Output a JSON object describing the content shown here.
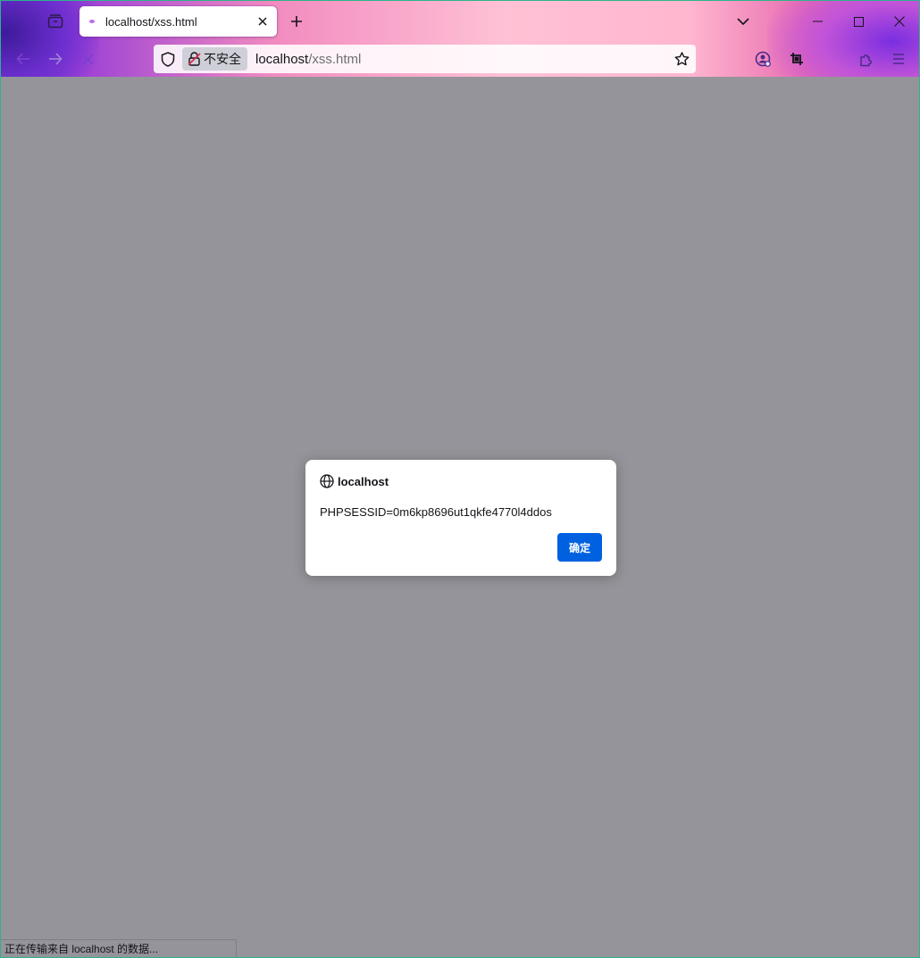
{
  "tab": {
    "title": "localhost/xss.html"
  },
  "urlbar": {
    "security_label": "不安全",
    "host": "localhost",
    "path": "/xss.html"
  },
  "icons": {
    "tab_tray": "firefox-view-icon",
    "close_tab": "close-icon",
    "new_tab": "plus-icon",
    "list_all_tabs": "chevron-down-icon",
    "back": "arrow-left-icon",
    "forward": "arrow-right-icon",
    "stop": "stop-icon",
    "tracking_protection": "shield-icon",
    "insecure": "broken-lock-icon",
    "bookmark": "star-icon",
    "account": "account-icon",
    "screenshot": "crop-icon",
    "extensions": "puzzle-icon",
    "menu": "hamburger-icon",
    "minimize": "minimize-icon",
    "maximize": "maximize-icon",
    "close_window": "close-icon",
    "dialog_host": "globe-icon"
  },
  "dialog": {
    "host": "localhost",
    "message": "PHPSESSID=0m6kp8696ut1qkfe4770l4ddos",
    "ok_label": "确定"
  },
  "status": {
    "text": "正在传输来自 localhost 的数据..."
  },
  "colors": {
    "content_overlay": "#95949a",
    "accent_button": "#0061e0"
  }
}
